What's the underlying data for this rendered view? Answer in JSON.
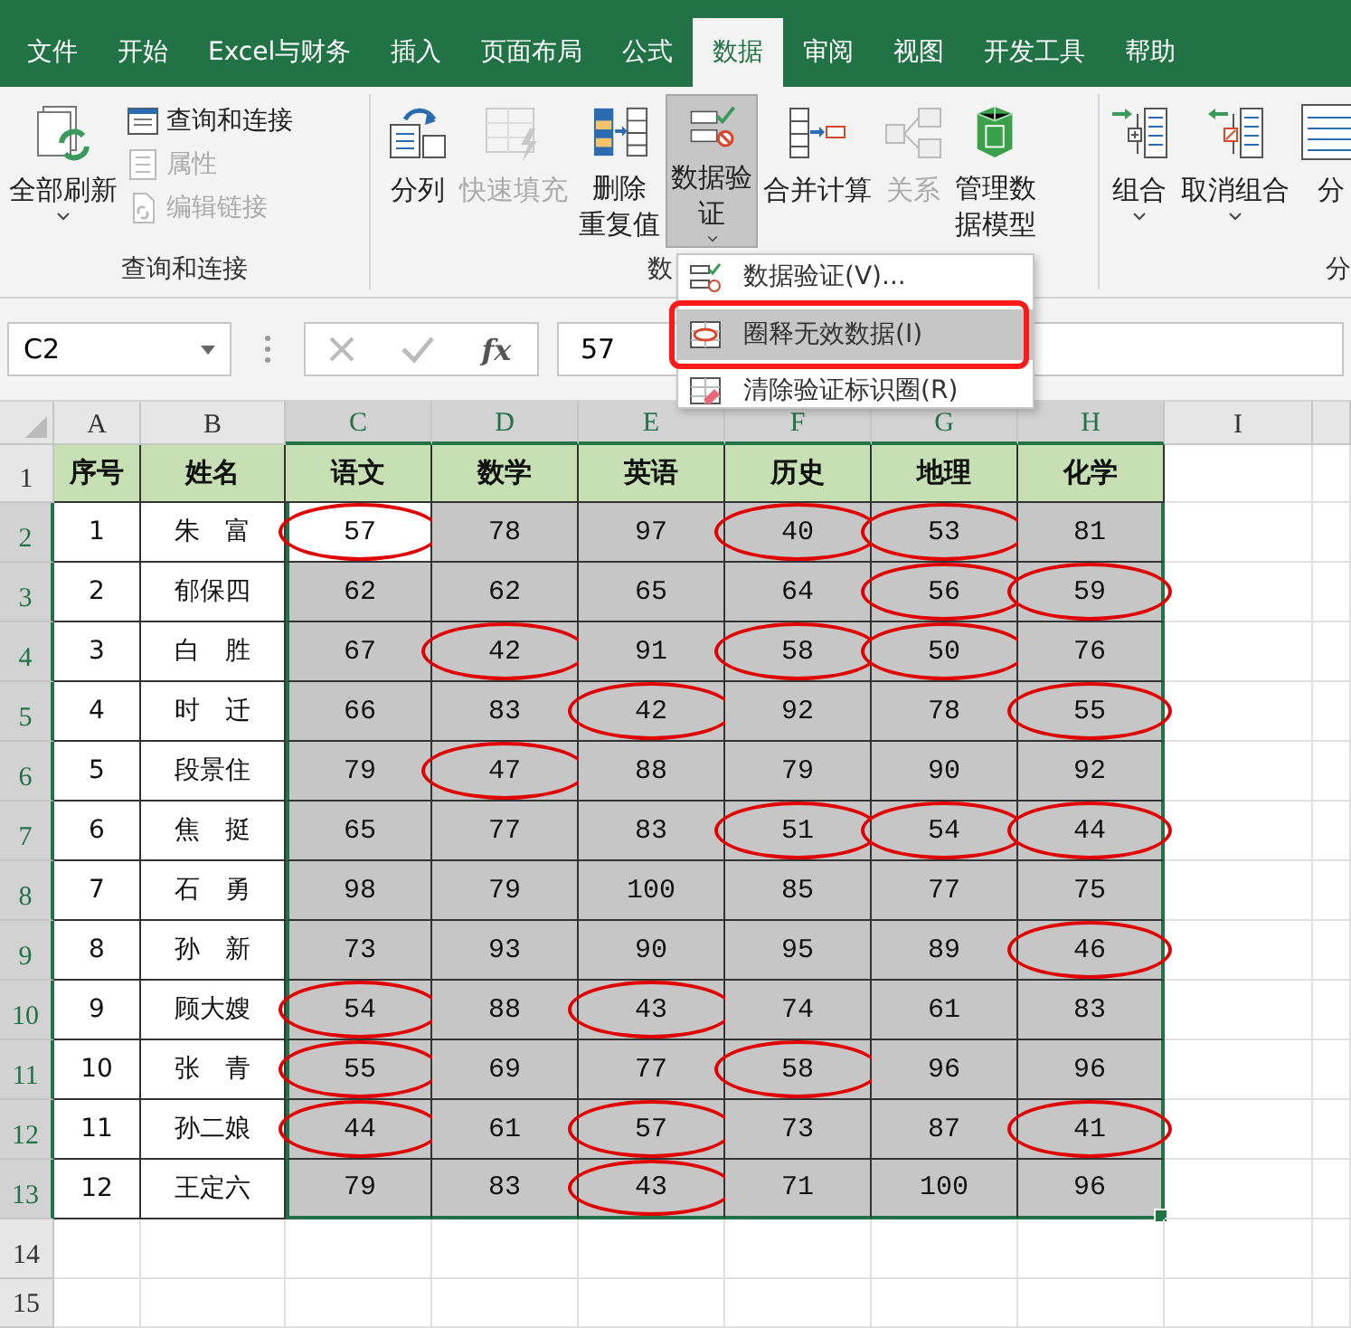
{
  "tabs": [
    {
      "label": "文件",
      "selected": false
    },
    {
      "label": "开始",
      "selected": false
    },
    {
      "label": "Excel与财务",
      "selected": false
    },
    {
      "label": "插入",
      "selected": false
    },
    {
      "label": "页面布局",
      "selected": false
    },
    {
      "label": "公式",
      "selected": false
    },
    {
      "label": "数据",
      "selected": true
    },
    {
      "label": "审阅",
      "selected": false
    },
    {
      "label": "视图",
      "selected": false
    },
    {
      "label": "开发工具",
      "selected": false
    },
    {
      "label": "帮助",
      "selected": false
    }
  ],
  "ribbon": {
    "groups": [
      {
        "label": "查询和连接",
        "large": [
          {
            "lines": [
              "全部刷新"
            ],
            "dropdown": true,
            "disabled": false,
            "pressed": false
          }
        ],
        "small": [
          {
            "label": "查询和连接",
            "disabled": false
          },
          {
            "label": "属性",
            "disabled": true
          },
          {
            "label": "编辑链接",
            "disabled": true
          }
        ]
      },
      {
        "label": "数",
        "large": [
          {
            "lines": [
              "分列"
            ],
            "dropdown": false,
            "disabled": false,
            "pressed": false
          },
          {
            "lines": [
              "快速填充"
            ],
            "dropdown": false,
            "disabled": true,
            "pressed": false
          },
          {
            "lines": [
              "删除",
              "重复值"
            ],
            "dropdown": false,
            "disabled": false,
            "pressed": false
          },
          {
            "lines": [
              "数据验",
              "证"
            ],
            "dropdown": true,
            "disabled": false,
            "pressed": true
          },
          {
            "lines": [
              "合并计算"
            ],
            "dropdown": false,
            "disabled": false,
            "pressed": false
          },
          {
            "lines": [
              "关系"
            ],
            "dropdown": false,
            "disabled": true,
            "pressed": false
          },
          {
            "lines": [
              "管理数",
              "据模型"
            ],
            "dropdown": false,
            "disabled": false,
            "pressed": false
          }
        ]
      },
      {
        "label": "分",
        "large": [
          {
            "lines": [
              "组合"
            ],
            "dropdown": true,
            "disabled": false,
            "pressed": false
          },
          {
            "lines": [
              "取消组合"
            ],
            "dropdown": true,
            "disabled": false,
            "pressed": false
          },
          {
            "lines": [
              "分"
            ],
            "dropdown": false,
            "disabled": false,
            "pressed": false
          }
        ]
      }
    ]
  },
  "formula_bar": {
    "name_box": "C2",
    "function_label": "fx",
    "value": "57"
  },
  "menu": {
    "items": [
      {
        "label": "数据验证(V)...",
        "selected": false,
        "annotated": false
      },
      {
        "label": "圈释无效数据(I)",
        "selected": true,
        "annotated": true
      },
      {
        "label": "清除验证标识圈(R)",
        "selected": false,
        "annotated": false
      }
    ]
  },
  "sheet": {
    "columns": [
      {
        "label": "A",
        "selected": false
      },
      {
        "label": "B",
        "selected": false
      },
      {
        "label": "C",
        "selected": true
      },
      {
        "label": "D",
        "selected": true
      },
      {
        "label": "E",
        "selected": true
      },
      {
        "label": "F",
        "selected": true
      },
      {
        "label": "G",
        "selected": true
      },
      {
        "label": "H",
        "selected": true
      },
      {
        "label": "I",
        "selected": false
      }
    ],
    "header_row": {
      "number": "1",
      "selected": false,
      "cells": [
        "序号",
        "姓名",
        "语文",
        "数学",
        "英语",
        "历史",
        "地理",
        "化学"
      ]
    },
    "rows": [
      {
        "number": "2",
        "selected": true,
        "no": "1",
        "name": "朱　富",
        "scores": [
          {
            "text": "57",
            "circled": true,
            "active": true
          },
          {
            "text": "78",
            "circled": false,
            "selected": true
          },
          {
            "text": "97",
            "circled": false,
            "selected": true
          },
          {
            "text": "40",
            "circled": true,
            "selected": true
          },
          {
            "text": "53",
            "circled": true,
            "selected": true
          },
          {
            "text": "81",
            "circled": false,
            "selected": true
          }
        ]
      },
      {
        "number": "3",
        "selected": true,
        "no": "2",
        "name": "郁保四",
        "scores": [
          {
            "text": "62",
            "circled": false,
            "selected": true
          },
          {
            "text": "62",
            "circled": false,
            "selected": true
          },
          {
            "text": "65",
            "circled": false,
            "selected": true
          },
          {
            "text": "64",
            "circled": false,
            "selected": true
          },
          {
            "text": "56",
            "circled": true,
            "selected": true
          },
          {
            "text": "59",
            "circled": true,
            "selected": true
          }
        ]
      },
      {
        "number": "4",
        "selected": true,
        "no": "3",
        "name": "白　胜",
        "scores": [
          {
            "text": "67",
            "circled": false,
            "selected": true
          },
          {
            "text": "42",
            "circled": true,
            "selected": true
          },
          {
            "text": "91",
            "circled": false,
            "selected": true
          },
          {
            "text": "58",
            "circled": true,
            "selected": true
          },
          {
            "text": "50",
            "circled": true,
            "selected": true
          },
          {
            "text": "76",
            "circled": false,
            "selected": true
          }
        ]
      },
      {
        "number": "5",
        "selected": true,
        "no": "4",
        "name": "时　迁",
        "scores": [
          {
            "text": "66",
            "circled": false,
            "selected": true
          },
          {
            "text": "83",
            "circled": false,
            "selected": true
          },
          {
            "text": "42",
            "circled": true,
            "selected": true
          },
          {
            "text": "92",
            "circled": false,
            "selected": true
          },
          {
            "text": "78",
            "circled": false,
            "selected": true
          },
          {
            "text": "55",
            "circled": true,
            "selected": true
          }
        ]
      },
      {
        "number": "6",
        "selected": true,
        "no": "5",
        "name": "段景住",
        "scores": [
          {
            "text": "79",
            "circled": false,
            "selected": true
          },
          {
            "text": "47",
            "circled": true,
            "selected": true
          },
          {
            "text": "88",
            "circled": false,
            "selected": true
          },
          {
            "text": "79",
            "circled": false,
            "selected": true
          },
          {
            "text": "90",
            "circled": false,
            "selected": true
          },
          {
            "text": "92",
            "circled": false,
            "selected": true
          }
        ]
      },
      {
        "number": "7",
        "selected": true,
        "no": "6",
        "name": "焦　挺",
        "scores": [
          {
            "text": "65",
            "circled": false,
            "selected": true
          },
          {
            "text": "77",
            "circled": false,
            "selected": true
          },
          {
            "text": "83",
            "circled": false,
            "selected": true
          },
          {
            "text": "51",
            "circled": true,
            "selected": true
          },
          {
            "text": "54",
            "circled": true,
            "selected": true
          },
          {
            "text": "44",
            "circled": true,
            "selected": true
          }
        ]
      },
      {
        "number": "8",
        "selected": true,
        "no": "7",
        "name": "石　勇",
        "scores": [
          {
            "text": "98",
            "circled": false,
            "selected": true
          },
          {
            "text": "79",
            "circled": false,
            "selected": true
          },
          {
            "text": "100",
            "circled": false,
            "selected": true
          },
          {
            "text": "85",
            "circled": false,
            "selected": true
          },
          {
            "text": "77",
            "circled": false,
            "selected": true
          },
          {
            "text": "75",
            "circled": false,
            "selected": true
          }
        ]
      },
      {
        "number": "9",
        "selected": true,
        "no": "8",
        "name": "孙　新",
        "scores": [
          {
            "text": "73",
            "circled": false,
            "selected": true
          },
          {
            "text": "93",
            "circled": false,
            "selected": true
          },
          {
            "text": "90",
            "circled": false,
            "selected": true
          },
          {
            "text": "95",
            "circled": false,
            "selected": true
          },
          {
            "text": "89",
            "circled": false,
            "selected": true
          },
          {
            "text": "46",
            "circled": true,
            "selected": true
          }
        ]
      },
      {
        "number": "10",
        "selected": true,
        "no": "9",
        "name": "顾大嫂",
        "scores": [
          {
            "text": "54",
            "circled": true,
            "selected": true
          },
          {
            "text": "88",
            "circled": false,
            "selected": true
          },
          {
            "text": "43",
            "circled": true,
            "selected": true
          },
          {
            "text": "74",
            "circled": false,
            "selected": true
          },
          {
            "text": "61",
            "circled": false,
            "selected": true
          },
          {
            "text": "83",
            "circled": false,
            "selected": true
          }
        ]
      },
      {
        "number": "11",
        "selected": true,
        "no": "10",
        "name": "张　青",
        "scores": [
          {
            "text": "55",
            "circled": true,
            "selected": true
          },
          {
            "text": "69",
            "circled": false,
            "selected": true
          },
          {
            "text": "77",
            "circled": false,
            "selected": true
          },
          {
            "text": "58",
            "circled": true,
            "selected": true
          },
          {
            "text": "96",
            "circled": false,
            "selected": true
          },
          {
            "text": "96",
            "circled": false,
            "selected": true
          }
        ]
      },
      {
        "number": "12",
        "selected": true,
        "no": "11",
        "name": "孙二娘",
        "scores": [
          {
            "text": "44",
            "circled": true,
            "selected": true
          },
          {
            "text": "61",
            "circled": false,
            "selected": true
          },
          {
            "text": "57",
            "circled": true,
            "selected": true
          },
          {
            "text": "73",
            "circled": false,
            "selected": true
          },
          {
            "text": "87",
            "circled": false,
            "selected": true
          },
          {
            "text": "41",
            "circled": true,
            "selected": true
          }
        ]
      },
      {
        "number": "13",
        "selected": true,
        "no": "12",
        "name": "王定六",
        "scores": [
          {
            "text": "79",
            "circled": false,
            "selected": true
          },
          {
            "text": "83",
            "circled": false,
            "selected": true
          },
          {
            "text": "43",
            "circled": true,
            "selected": true
          },
          {
            "text": "71",
            "circled": false,
            "selected": true
          },
          {
            "text": "100",
            "circled": false,
            "selected": true
          },
          {
            "text": "96",
            "circled": false,
            "selected": true
          }
        ]
      }
    ],
    "empty_rows": [
      {
        "number": "14"
      },
      {
        "number": "15"
      }
    ]
  }
}
